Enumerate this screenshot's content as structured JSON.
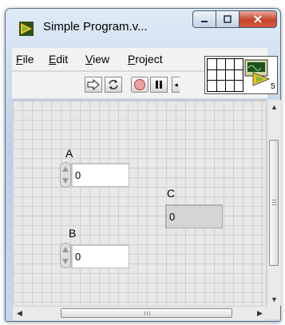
{
  "window": {
    "title": "Simple Program.v...",
    "caption_buttons": {
      "minimize": "—",
      "maximize": "▢",
      "close": "✕"
    }
  },
  "menubar": {
    "items": [
      "File",
      "Edit",
      "View",
      "Project"
    ]
  },
  "toolbar": {
    "buttons": [
      "run-arrow",
      "run-continuously",
      "abort-execution",
      "pause"
    ],
    "overflow_glyph": "◂"
  },
  "vi_icon": {
    "badge": "5"
  },
  "front_panel": {
    "controls": [
      {
        "label": "A",
        "value": "0",
        "kind": "numeric-control"
      },
      {
        "label": "B",
        "value": "0",
        "kind": "numeric-control"
      }
    ],
    "indicators": [
      {
        "label": "C",
        "value": "0",
        "kind": "numeric-indicator"
      }
    ]
  },
  "scrollbars": {
    "up": "▲",
    "down": "▼",
    "left": "◀",
    "right": "▶",
    "v_grip": "≡",
    "h_grip": "|||"
  },
  "colors": {
    "titlebar": "#bcd0e6",
    "close_button": "#c7432a",
    "panel_grid": "#e8e8e8"
  }
}
